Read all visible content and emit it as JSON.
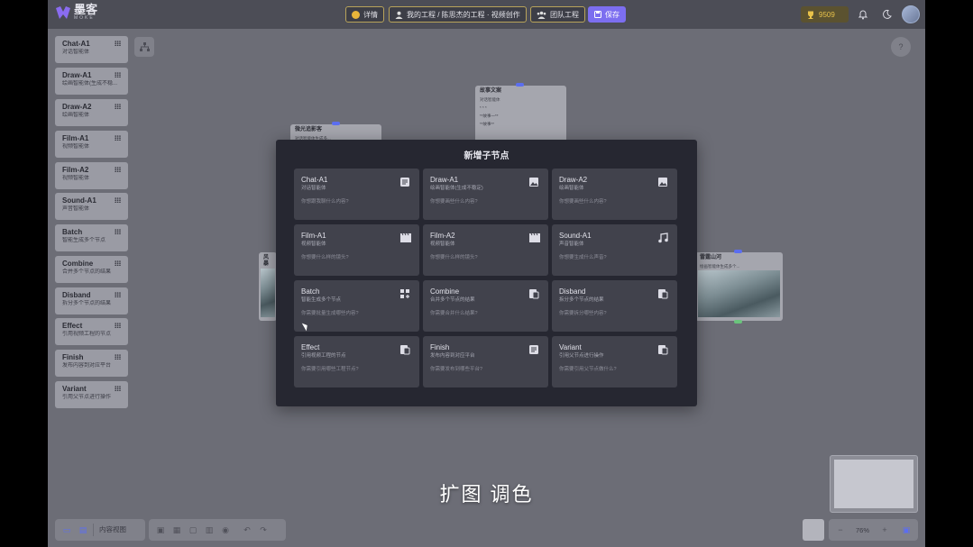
{
  "app": {
    "name": "墨客",
    "sub": "MOKE"
  },
  "topbar": {
    "details": "详情",
    "project": "我的工程 / 陈思杰的工程 · 视频创作",
    "team": "团队工程",
    "save": "保存",
    "coins": "9509"
  },
  "sidebar": [
    {
      "title": "Chat-A1",
      "desc": "对话智能体"
    },
    {
      "title": "Draw-A1",
      "desc": "绘画智能体(生成不稳..."
    },
    {
      "title": "Draw-A2",
      "desc": "绘画智能体"
    },
    {
      "title": "Film-A1",
      "desc": "视频智能体"
    },
    {
      "title": "Film-A2",
      "desc": "视频智能体"
    },
    {
      "title": "Sound-A1",
      "desc": "声音智能体"
    },
    {
      "title": "Batch",
      "desc": "智能生成多个节点"
    },
    {
      "title": "Combine",
      "desc": "合并多个节点的结果"
    },
    {
      "title": "Disband",
      "desc": "拆分多个节点的结果"
    },
    {
      "title": "Effect",
      "desc": "引用视频工程的节点"
    },
    {
      "title": "Finish",
      "desc": "发布内容到对应平台"
    },
    {
      "title": "Variant",
      "desc": "引用父节点进行操作"
    }
  ],
  "canvas_nodes": {
    "story": {
      "title": "故事文案",
      "sub": "对话智能体",
      "line1": "* * *",
      "line2": "**故事一**",
      "line3": "**故事**"
    },
    "light": {
      "title": "微光追影客",
      "sub": "对话智能体生成多..."
    },
    "left": {
      "title": "风暴"
    },
    "right": {
      "title": "雷霆山河",
      "sub": "绘画智能体生成多个..."
    }
  },
  "modal": {
    "title": "新增子节点",
    "options": [
      {
        "title": "Chat-A1",
        "desc": "对话智能体",
        "prompt": "你想跟我聊什么内容?",
        "icon": "document-icon"
      },
      {
        "title": "Draw-A1",
        "desc": "绘画智能体(生成不稳定)",
        "prompt": "你想要画些什么内容?",
        "icon": "image-icon"
      },
      {
        "title": "Draw-A2",
        "desc": "绘画智能体",
        "prompt": "你想要画些什么内容?",
        "icon": "image-icon"
      },
      {
        "title": "Film-A1",
        "desc": "视频智能体",
        "prompt": "你想要什么样的镜头?",
        "icon": "clapperboard-icon"
      },
      {
        "title": "Film-A2",
        "desc": "视频智能体",
        "prompt": "你想要什么样的镜头?",
        "icon": "clapperboard-icon"
      },
      {
        "title": "Sound-A1",
        "desc": "声音智能体",
        "prompt": "你想要生成什么声音?",
        "icon": "music-note-icon"
      },
      {
        "title": "Batch",
        "desc": "智能生成多个节点",
        "prompt": "你需要批量生成哪些内容?",
        "icon": "grid-plus-icon"
      },
      {
        "title": "Combine",
        "desc": "合并多个节点的结果",
        "prompt": "你需要合并什么结果?",
        "icon": "merge-icon"
      },
      {
        "title": "Disband",
        "desc": "拆分多个节点的结果",
        "prompt": "你需要拆分哪些内容?",
        "icon": "split-icon"
      },
      {
        "title": "Effect",
        "desc": "引用视频工程的节点",
        "prompt": "你需要引用哪些工程节点?",
        "icon": "link-icon"
      },
      {
        "title": "Finish",
        "desc": "发布内容到对应平台",
        "prompt": "你需要发布到哪些平台?",
        "icon": "publish-icon"
      },
      {
        "title": "Variant",
        "desc": "引用父节点进行操作",
        "prompt": "你需要引用父节点做什么?",
        "icon": "branch-icon"
      }
    ]
  },
  "bottombar": {
    "content_view": "内容视图",
    "zoom": "76%"
  },
  "caption": "扩图 调色"
}
